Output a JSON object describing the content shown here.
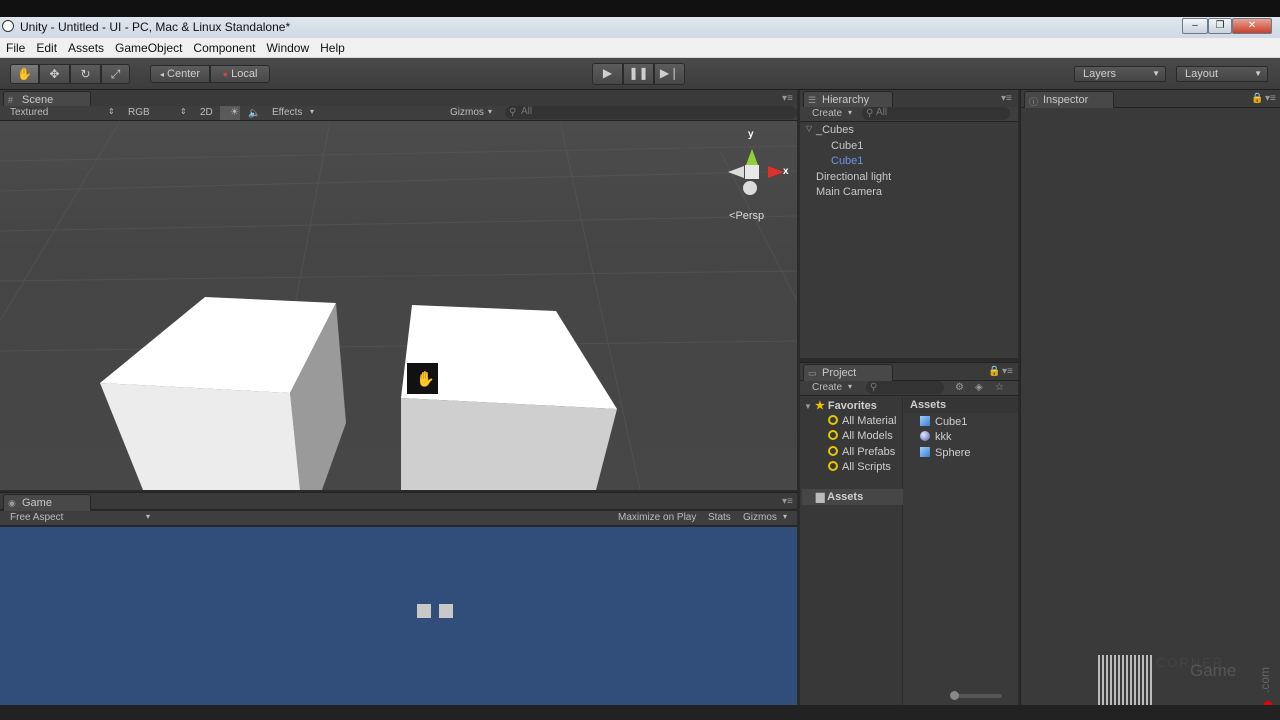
{
  "window": {
    "title": "Unity - Untitled - UI - PC, Mac & Linux Standalone*",
    "buttons": [
      "‒",
      "❐",
      "✕"
    ]
  },
  "menu": [
    "File",
    "Edit",
    "Assets",
    "GameObject",
    "Component",
    "Window",
    "Help"
  ],
  "toolbar": {
    "pivot": "Center",
    "space": "Local",
    "layers": "Layers",
    "layout": "Layout"
  },
  "scene": {
    "tab": "Scene",
    "shading": "Textured",
    "render_mode": "RGB",
    "mode_2d": "2D",
    "effects": "Effects",
    "gizmos": "Gizmos",
    "search_placeholder": "All",
    "gizmo": {
      "y": "y",
      "x": "x",
      "persp": "Persp"
    }
  },
  "game": {
    "tab": "Game",
    "aspect": "Free Aspect",
    "maximize": "Maximize on Play",
    "stats": "Stats",
    "gizmos": "Gizmos"
  },
  "hierarchy": {
    "tab": "Hierarchy",
    "create": "Create",
    "search_placeholder": "All",
    "items": [
      {
        "label": "_Cubes",
        "selected": false
      },
      {
        "label": "Cube1",
        "selected": false
      },
      {
        "label": "Cube1",
        "selected": true
      },
      {
        "label": "Directional light",
        "selected": false
      },
      {
        "label": "Main Camera",
        "selected": false
      }
    ]
  },
  "inspector": {
    "tab": "Inspector"
  },
  "project": {
    "tab": "Project",
    "create": "Create",
    "favorites": {
      "title": "Favorites",
      "items": [
        "All Material",
        "All Models",
        "All Prefabs",
        "All Scripts"
      ]
    },
    "assets_folder": "Assets",
    "assets_header": "Assets",
    "assets": [
      {
        "label": "Cube1",
        "icon": "prefab-icon"
      },
      {
        "label": "kkk",
        "icon": "material-icon"
      },
      {
        "label": "Sphere",
        "icon": "prefab-icon"
      }
    ]
  },
  "watermark": {
    "line1": "CORNER",
    "line2": "Game",
    "line3": ".com"
  },
  "colors": {
    "selected_text": "#6a95e5",
    "game_bg": "#314d79",
    "gizmo_x": "#e0302a",
    "gizmo_y": "#8fcf3a"
  }
}
